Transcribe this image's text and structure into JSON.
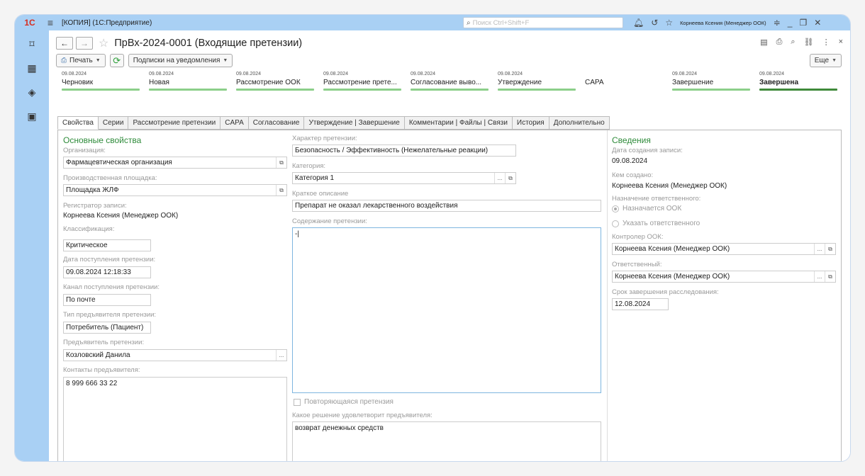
{
  "topbar": {
    "logo": "1С",
    "title": "[КОПИЯ]  (1С:Предприятие)",
    "search_placeholder": "Поиск Ctrl+Shift+F",
    "user": "Корнеева Ксения (Менеджер ООК)"
  },
  "doc": {
    "title": "ПрВх-2024-0001 (Входящие претензии)"
  },
  "toolbar": {
    "print_label": "Печать",
    "subscriptions_label": "Подписки на уведомления",
    "more_label": "Еще"
  },
  "stages": [
    {
      "date": "09.08.2024",
      "name": "Черновик"
    },
    {
      "date": "09.08.2024",
      "name": "Новая"
    },
    {
      "date": "09.08.2024",
      "name": "Рассмотрение ООК"
    },
    {
      "date": "09.08.2024",
      "name": "Рассмотрение прете..."
    },
    {
      "date": "09.08.2024",
      "name": "Согласование выво..."
    },
    {
      "date": "09.08.2024",
      "name": "Утверждение"
    },
    {
      "date": "",
      "name": "CAPA"
    },
    {
      "date": "09.08.2024",
      "name": "Завершение"
    },
    {
      "date": "09.08.2024",
      "name": "Завершена"
    }
  ],
  "tabs": [
    "Свойства",
    "Серии",
    "Рассмотрение претензии",
    "CAPA",
    "Согласование",
    "Утверждение | Завершение",
    "Комментарии | Файлы | Связи",
    "История",
    "Дополнительно"
  ],
  "left": {
    "section_title": "Основные свойства",
    "org_label": "Организация:",
    "org_value": "Фармацевтическая организация",
    "site_label": "Производственная площадка:",
    "site_value": "Площадка ЖЛФ",
    "registrar_label": "Регистратор записи:",
    "registrar_value": "Корнеева Ксения (Менеджер ООК)",
    "class_label": "Классификация:",
    "class_value": "Критическое",
    "date_label": "Дата поступления претензии:",
    "date_value": "09.08.2024 12:18:33",
    "channel_label": "Канал поступления претензии:",
    "channel_value": "По почте",
    "claimant_type_label": "Тип предъявителя претензии:",
    "claimant_type_value": "Потребитель (Пациент)",
    "claimant_label": "Предъявитель претензии:",
    "claimant_value": "Козловский Данила",
    "contacts_label": "Контакты предъявителя:",
    "contacts_value": "8 999 666 33 22"
  },
  "middle": {
    "nature_label": "Характер претензии:",
    "nature_value": "Безопасность / Эффективность (Нежелательные реакции)",
    "category_label": "Категория:",
    "category_value": "Категория 1",
    "short_label": "Краткое описание",
    "short_value": "Препарат не оказал лекарственного воздействия",
    "content_label": "Содержание претензии:",
    "content_value": "-|",
    "repeat_label": "Повторяющаяся претензия",
    "decision_label": "Какое решение удовлетворит предъявителя:",
    "decision_value": "возврат денежных средств"
  },
  "right": {
    "section_title": "Сведения",
    "created_label": "Дата создания записи:",
    "created_value": "09.08.2024",
    "author_label": "Кем создано:",
    "author_value": "Корнеева Ксения (Менеджер ООК)",
    "assign_label": "Назначение ответственного:",
    "assign_opt1": "Назначается ООК",
    "assign_opt2": "Указать ответственного",
    "controller_label": "Контролер ООК:",
    "controller_value": "Корнеева Ксения (Менеджер ООК)",
    "responsible_label": "Ответственный:",
    "responsible_value": "Корнеева Ксения (Менеджер ООК)",
    "deadline_label": "Срок завершения расследования:",
    "deadline_value": "12.08.2024"
  }
}
